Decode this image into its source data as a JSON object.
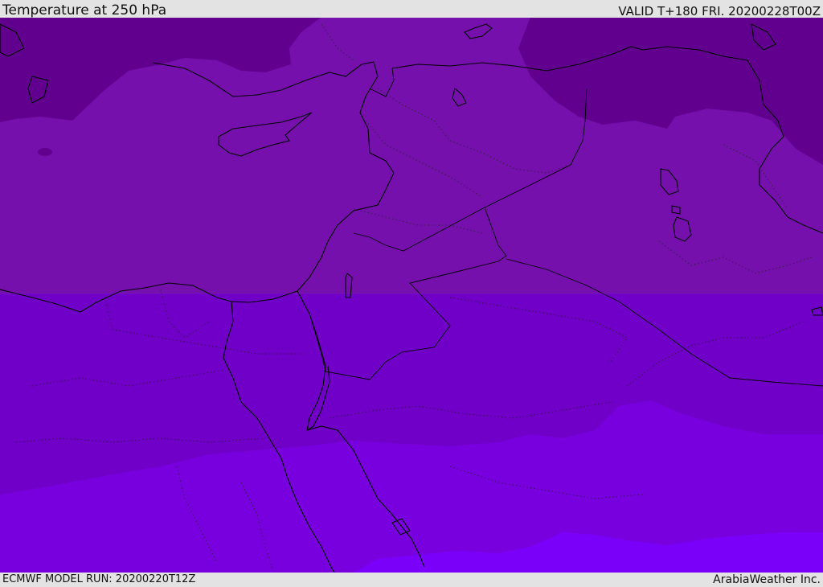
{
  "header": {
    "title": "Temperature at 250 hPa",
    "valid_time": "VALID T+180 FRI. 20200228T00Z"
  },
  "footer": {
    "model_run": "ECMWF MODEL RUN: 20200220T12Z",
    "provider": "ArabiaWeather Inc."
  },
  "map": {
    "colors": {
      "band_coldest": "#61008f",
      "band_cold": "#7510ad",
      "band_mid": "#7000c8",
      "band_warm": "#7800de",
      "band_warmest": "#7a00fa",
      "coastline": "#000000"
    }
  }
}
